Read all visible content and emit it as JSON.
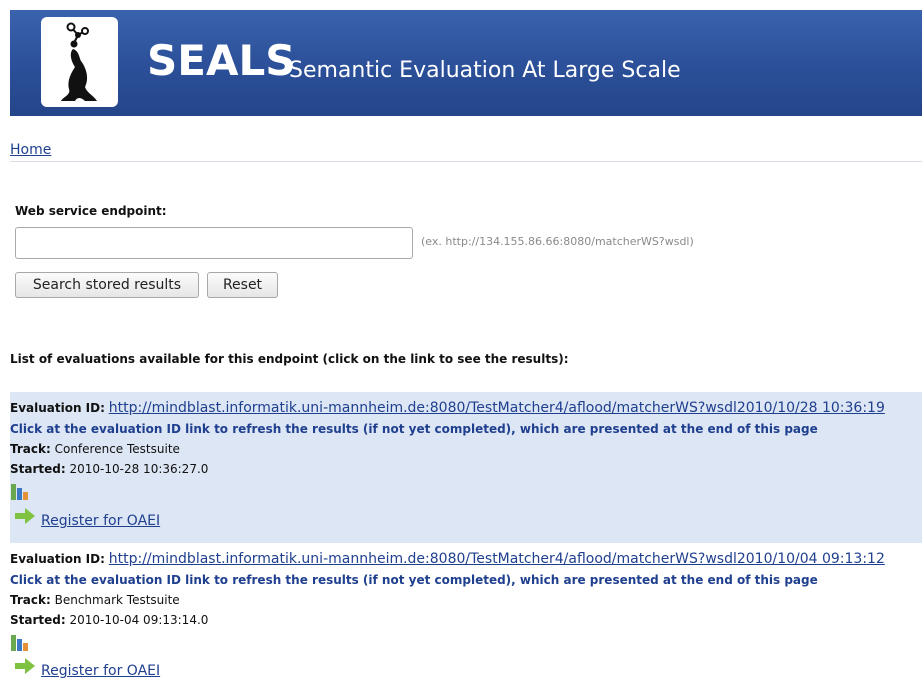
{
  "banner": {
    "title": "SEALS",
    "subtitle": "Semantic Evaluation At Large Scale",
    "logo_icon": "seal-logo-icon",
    "background_color": "#2b4f98"
  },
  "breadcrumb": {
    "home_label": "Home"
  },
  "search": {
    "label": "Web service endpoint:",
    "value": "",
    "placeholder": "",
    "hint": "(ex. http://134.155.86.66:8080/matcherWS?wsdl)",
    "search_button": "Search stored results",
    "reset_button": "Reset"
  },
  "list_heading": "List of evaluations available for this endpoint (click on the link to see the results):",
  "labels": {
    "evaluation_id": "Evaluation ID:",
    "track": "Track:",
    "started": "Started:",
    "refresh_note": "Click at the evaluation ID link to refresh the results (if not yet completed), which are presented at the end of this page",
    "register": "Register for OAEI"
  },
  "evaluations": [
    {
      "id_link": "http://mindblast.informatik.uni-mannheim.de:8080/TestMatcher4/aflood/matcherWS?wsdl2010/10/28 10:36:19",
      "track": "Conference Testsuite",
      "started": "2010-10-28 10:36:27.0",
      "chart_icon": "bar-chart-icon",
      "register_icon": "green-arrow-icon"
    },
    {
      "id_link": "http://mindblast.informatik.uni-mannheim.de:8080/TestMatcher4/aflood/matcherWS?wsdl2010/10/04 09:13:12",
      "track": "Benchmark Testsuite",
      "started": "2010-10-04 09:13:14.0",
      "chart_icon": "bar-chart-icon",
      "register_icon": "green-arrow-icon"
    }
  ],
  "colors": {
    "link": "#1f3f8f",
    "highlight_row": "#dde6f4",
    "arrow": "#7fc241"
  }
}
